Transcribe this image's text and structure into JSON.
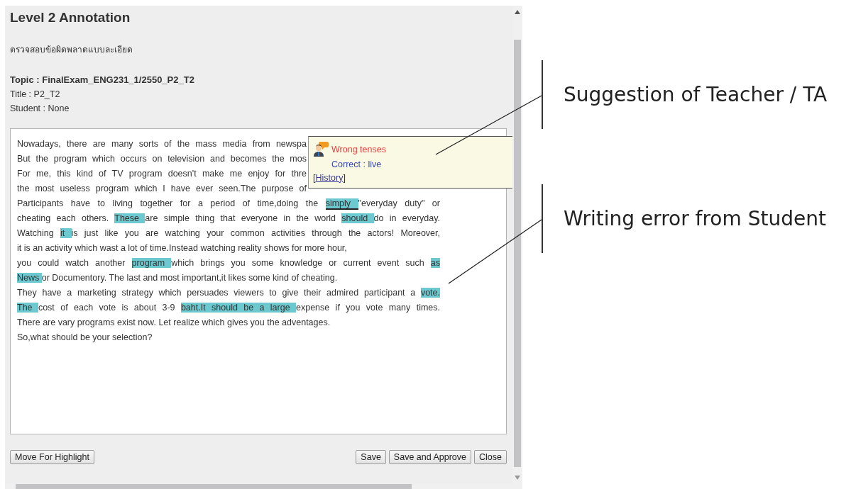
{
  "dialog": {
    "title": "Level 2 Annotation",
    "subtitle": "ตรวจสอบข้อผิดพลาดแบบละเอียด",
    "topic": "Topic : FinalExam_ENG231_1/2550_P2_T2",
    "title_line": "Title : P2_T2",
    "student": "Student : None"
  },
  "essay": {
    "lines": [
      {
        "kind": "cut",
        "segments": [
          {
            "text": "Nowadays, there are many sorts of the mass media from newspa",
            "highlighted": false,
            "selected": false
          }
        ]
      },
      {
        "kind": "cut",
        "segments": [
          {
            "text": "But the program which occurs on television and becomes the mos",
            "highlighted": false,
            "selected": false
          }
        ]
      },
      {
        "kind": "cut",
        "segments": [
          {
            "text": "For me, this kind of TV program doesn't make me enjoy for thre",
            "highlighted": false,
            "selected": false
          }
        ]
      },
      {
        "kind": "cut",
        "segments": [
          {
            "text": "the most useless program which I have ever seen.The purpose of",
            "highlighted": false,
            "selected": false
          }
        ]
      },
      {
        "kind": "full",
        "segments": [
          {
            "text": "Participants have to living together for a period of time,doing the ",
            "highlighted": false,
            "selected": false
          },
          {
            "text": "simply ",
            "highlighted": true,
            "selected": true
          },
          {
            "text": "\"everyday duty\" or",
            "highlighted": false,
            "selected": false
          }
        ]
      },
      {
        "kind": "full",
        "segments": [
          {
            "text": "cheating each others. ",
            "highlighted": false,
            "selected": false
          },
          {
            "text": "These ",
            "highlighted": true,
            "selected": false
          },
          {
            "text": "are simple thing that everyone in the world ",
            "highlighted": false,
            "selected": false
          },
          {
            "text": "should ",
            "highlighted": true,
            "selected": false
          },
          {
            "text": "do in everyday.",
            "highlighted": false,
            "selected": false
          }
        ]
      },
      {
        "kind": "full",
        "segments": [
          {
            "text": "Watching ",
            "highlighted": false,
            "selected": false
          },
          {
            "text": "it ",
            "highlighted": true,
            "selected": false
          },
          {
            "text": "is just like you are watching your common activities through the actors! Moreover,",
            "highlighted": false,
            "selected": false
          }
        ]
      },
      {
        "kind": "short",
        "segments": [
          {
            "text": "it is an activity which wast a lot of time.Instead watching reality shows for more hour,",
            "highlighted": false,
            "selected": false
          }
        ]
      },
      {
        "kind": "full",
        "segments": [
          {
            "text": "you could watch another ",
            "highlighted": false,
            "selected": false
          },
          {
            "text": "program ",
            "highlighted": true,
            "selected": false
          },
          {
            "text": "which brings you some knowledge or current event such ",
            "highlighted": false,
            "selected": false
          },
          {
            "text": "as",
            "highlighted": true,
            "selected": false
          }
        ]
      },
      {
        "kind": "short",
        "segments": [
          {
            "text": "News ",
            "highlighted": true,
            "selected": false
          },
          {
            "text": "or Documentory. The last and most important,it likes some kind of cheating.",
            "highlighted": false,
            "selected": false
          }
        ]
      },
      {
        "kind": "full",
        "segments": [
          {
            "text": "They have a marketing strategy which persuades viewers to give their admired participant a ",
            "highlighted": false,
            "selected": false
          },
          {
            "text": "vote.",
            "highlighted": true,
            "selected": false
          }
        ]
      },
      {
        "kind": "full",
        "segments": [
          {
            "text": "The ",
            "highlighted": true,
            "selected": false
          },
          {
            "text": "cost of each vote is about 3-9 ",
            "highlighted": false,
            "selected": false
          },
          {
            "text": "baht.It should be a large ",
            "highlighted": true,
            "selected": false
          },
          {
            "text": "expense if you vote many times.",
            "highlighted": false,
            "selected": false
          }
        ]
      },
      {
        "kind": "short",
        "segments": [
          {
            "text": "There are vary programs exist now. Let realize which gives you the adventages.",
            "highlighted": false,
            "selected": false
          }
        ]
      },
      {
        "kind": "short",
        "segments": [
          {
            "text": "So,what should be your selection?",
            "highlighted": false,
            "selected": false
          }
        ]
      }
    ]
  },
  "tooltip": {
    "error": "Wrong tenses",
    "correction": "Correct : live",
    "history_open": "[",
    "history_link": "History",
    "history_close": "]"
  },
  "left_buttons": [
    "Move For Highlight"
  ],
  "right_buttons": [
    "Save",
    "Save and Approve",
    "Close"
  ],
  "annotations": [
    {
      "text": "Suggestion of Teacher / TA"
    },
    {
      "text": "Writing error from Student"
    }
  ]
}
